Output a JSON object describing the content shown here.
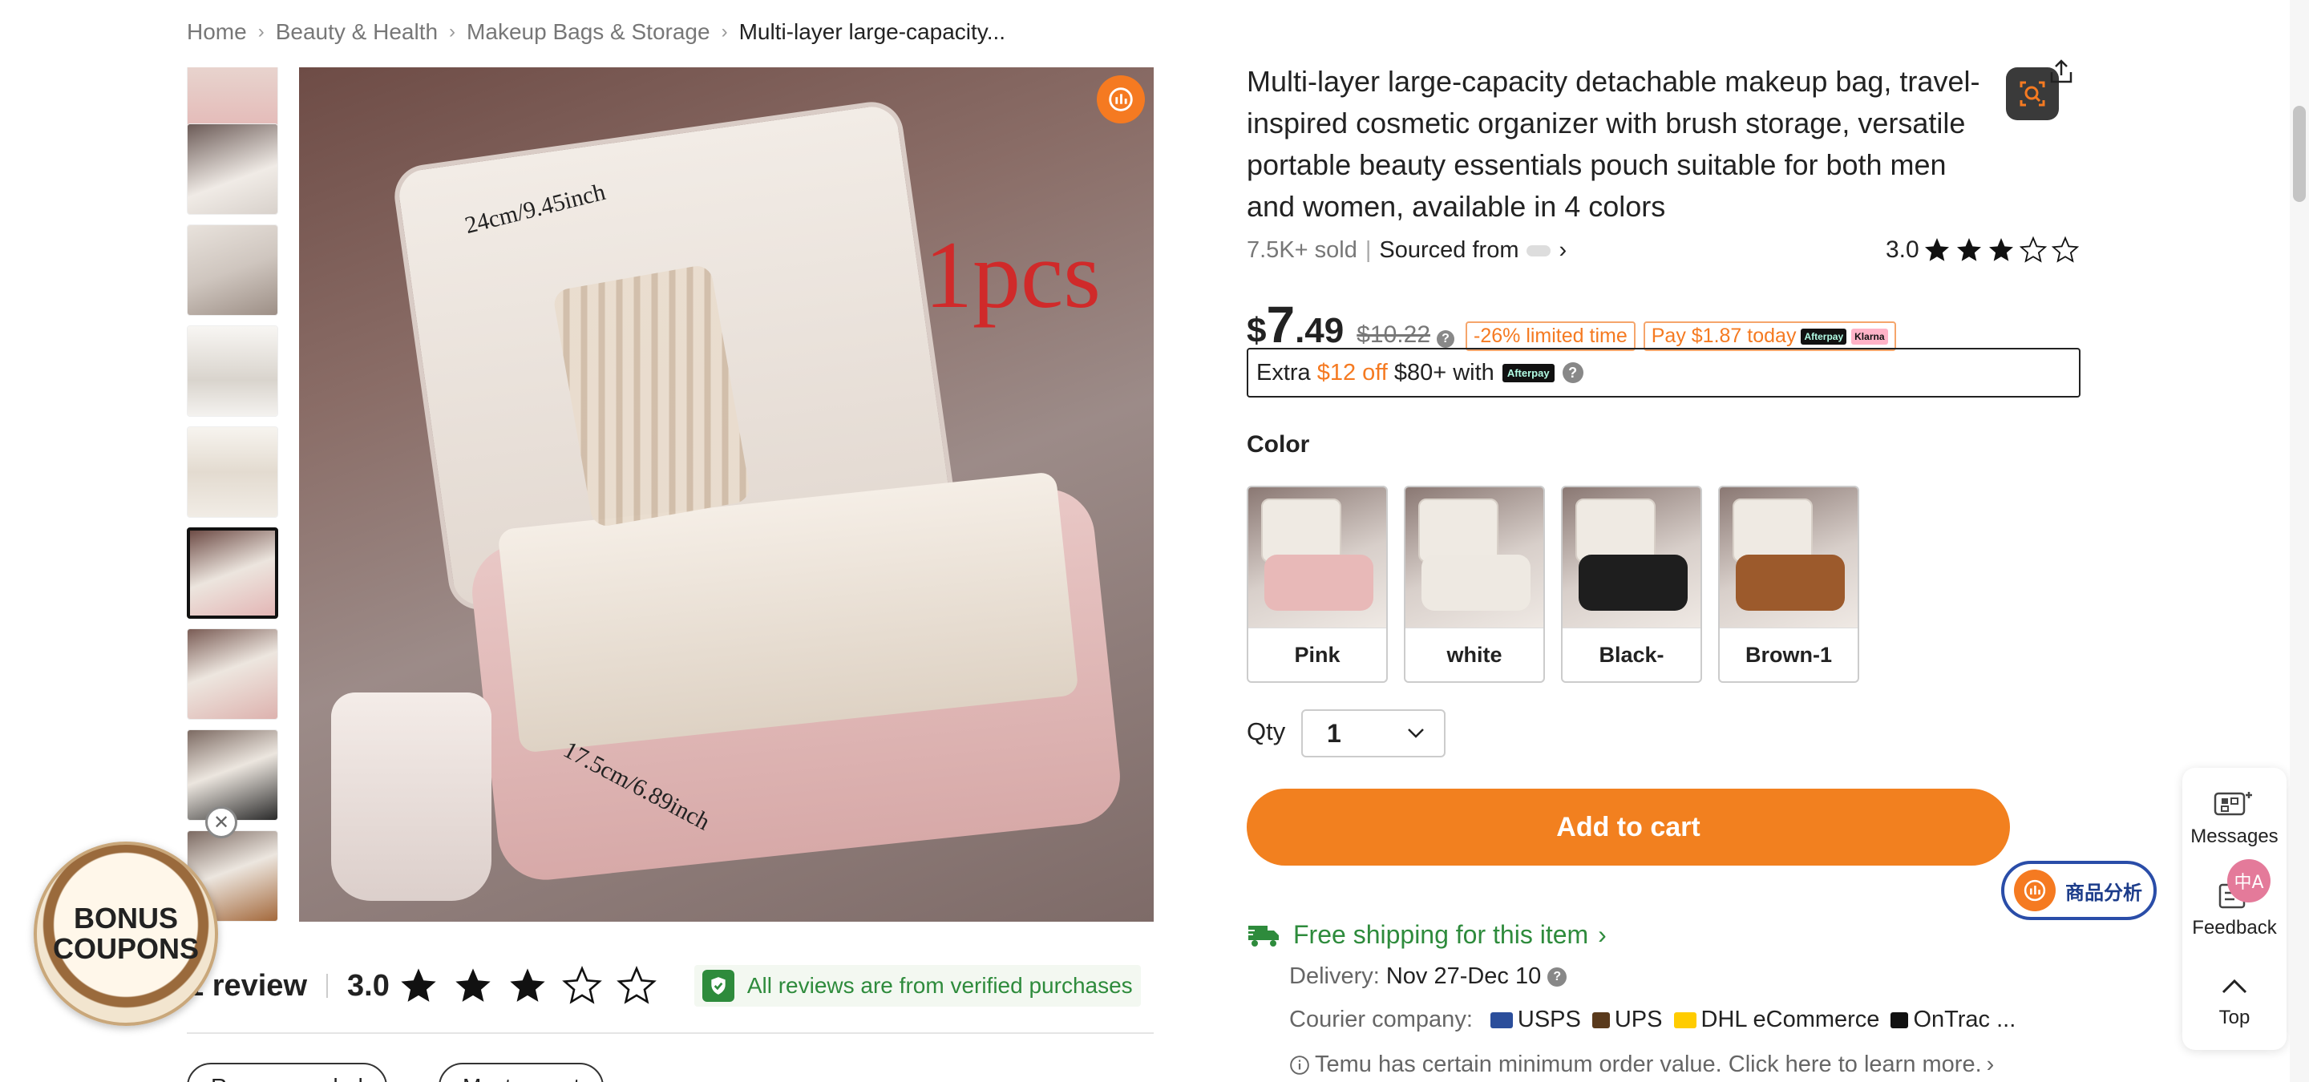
{
  "breadcrumb": {
    "items": [
      "Home",
      "Beauty & Health",
      "Makeup Bags & Storage"
    ],
    "current": "Multi-layer large-capacity..."
  },
  "gallery": {
    "image_text": {
      "size_top": "24cm/9.45inch",
      "size_bottom": "17.5cm/6.89inch",
      "pcs": "1pcs"
    },
    "selected_index": 5
  },
  "reviews": {
    "count_text": "1 review",
    "rating": "3.0",
    "stars_filled": 3,
    "verified_text": "All reviews are from verified purchases",
    "sort_labels": [
      "Recommended",
      "Most recent"
    ]
  },
  "product": {
    "title": "Multi-layer large-capacity detachable makeup bag, travel-inspired cosmetic organizer with brush storage, versatile portable beauty essentials pouch suitable for both men and women, available in 4 colors",
    "sold": "7.5K+ sold",
    "sourced_from": "Sourced from",
    "rating": "3.0",
    "stars_filled": 3
  },
  "price": {
    "currency": "$",
    "integer": "7",
    "decimal": ".49",
    "old": "$10.22",
    "discount": "-26% limited time",
    "pay_today": "Pay $1.87 today",
    "afterpay_logo": "Afterpay",
    "klarna_logo": "Klarna",
    "extra_prefix": "Extra",
    "extra_amount": "$12 off",
    "extra_suffix": "$80+ with"
  },
  "color": {
    "label": "Color",
    "options": [
      {
        "label": "Pink",
        "case_color": "#e8b9b8"
      },
      {
        "label": "white",
        "case_color": "#eee9e2"
      },
      {
        "label": "Black-",
        "case_color": "#1e1e1e"
      },
      {
        "label": "Brown-1",
        "case_color": "#9c5a2c"
      }
    ]
  },
  "qty": {
    "label": "Qty",
    "value": "1"
  },
  "cart": {
    "label": "Add to cart"
  },
  "analysis_pill": {
    "label": "商品分析"
  },
  "shipping": {
    "free_text": "Free shipping for this item",
    "delivery_label": "Delivery:",
    "delivery_value": "Nov 27-Dec 10",
    "courier_label": "Courier company:",
    "couriers": [
      "USPS",
      "UPS",
      "DHL eCommerce",
      "OnTrac ..."
    ],
    "min_note": "Temu has certain minimum order value. Click here to learn more."
  },
  "float_panel": {
    "messages": "Messages",
    "feedback": "Feedback",
    "top": "Top",
    "lang": "中A"
  },
  "bonus": {
    "line1": "BONUS",
    "line2": "COUPONS"
  },
  "colors": {
    "accent": "#f2801f",
    "green": "#2e8b3c",
    "blue": "#2a4da8"
  }
}
